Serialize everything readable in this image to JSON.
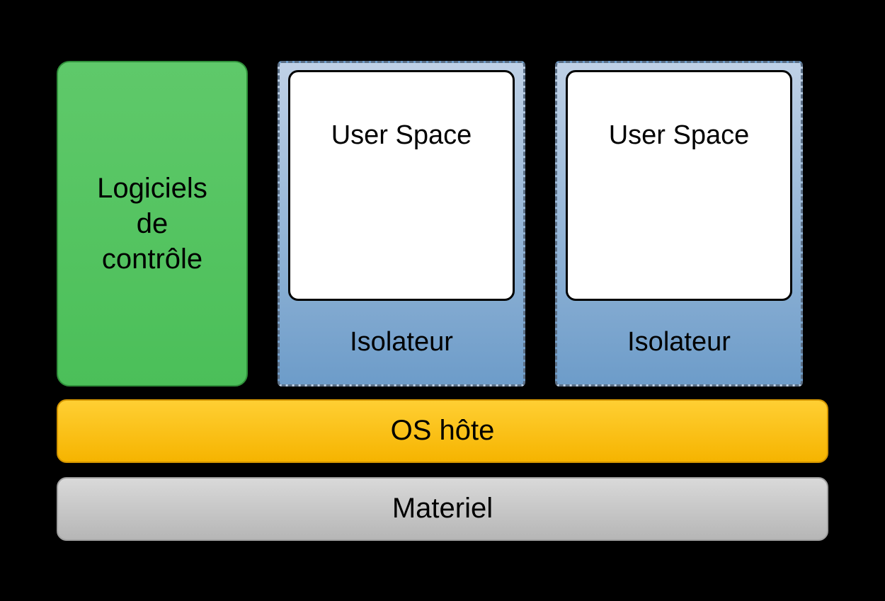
{
  "control": {
    "label": "Logiciels\nde\ncontrôle"
  },
  "containers": [
    {
      "user_space": "User Space",
      "isolator": "Isolateur"
    },
    {
      "user_space": "User Space",
      "isolator": "Isolateur"
    }
  ],
  "os": {
    "label": "OS hôte"
  },
  "hardware": {
    "label": "Materiel"
  }
}
